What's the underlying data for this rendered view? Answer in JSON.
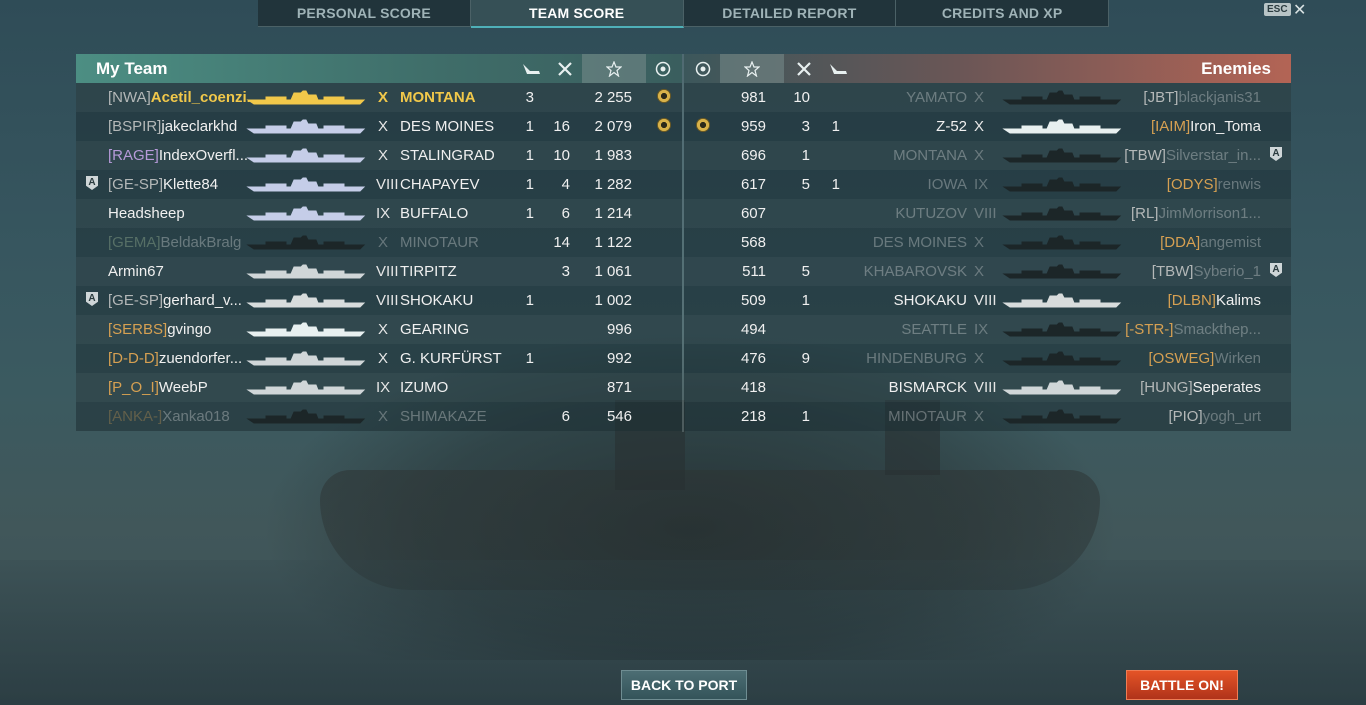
{
  "tabs": [
    "PERSONAL SCORE",
    "TEAM SCORE",
    "DETAILED REPORT",
    "CREDITS AND XP"
  ],
  "esc_label": "ESC",
  "close_glyph": "✕",
  "left_panel": {
    "title": "My Team",
    "rows": [
      {
        "tag": "[NWA]",
        "name": "Acetil_coenzi...",
        "tier": "X",
        "ship": "MONTANA",
        "c1": "3",
        "c2": "",
        "score": "2 255",
        "medal": true,
        "highlight": true,
        "dead": false,
        "tag_color": "grey",
        "sil_color": "#f1c84a"
      },
      {
        "tag": "[BSPIR]",
        "name": "jakeclarkhd",
        "tier": "X",
        "ship": "DES MOINES",
        "c1": "1",
        "c2": "16",
        "score": "2 079",
        "medal": true,
        "dead": false,
        "tag_color": "grey",
        "sil_color": "#c5cde8"
      },
      {
        "tag": "[RAGE]",
        "name": "IndexOverfl...",
        "tier": "X",
        "ship": "STALINGRAD",
        "c1": "1",
        "c2": "10",
        "score": "1 983",
        "dead": false,
        "tag_color": "purple",
        "sil_color": "#c5cde8"
      },
      {
        "tag": "[GE-SP]",
        "name": "Klette84",
        "tier": "VIII",
        "ship": "CHAPAYEV",
        "c1": "1",
        "c2": "4",
        "score": "1 282",
        "dead": false,
        "tag_color": "grey",
        "sil_color": "#c5cde8",
        "division": true
      },
      {
        "tag": "",
        "name": "Headsheep",
        "tier": "IX",
        "ship": "BUFFALO",
        "c1": "1",
        "c2": "6",
        "score": "1 214",
        "dead": false,
        "tag_color": "grey",
        "sil_color": "#c5cde8"
      },
      {
        "tag": "[GEMA]",
        "name": "BeldakBralg",
        "tier": "X",
        "ship": "MINOTAUR",
        "c1": "",
        "c2": "14",
        "score": "1 122",
        "dead": true,
        "tag_color": "green",
        "sil_color": "#1c2628"
      },
      {
        "tag": "",
        "name": "Armin67",
        "tier": "VIII",
        "ship": "TIRPITZ",
        "c1": "",
        "c2": "3",
        "score": "1 061",
        "dead": false,
        "tag_color": "grey",
        "sil_color": "#d0d6d8"
      },
      {
        "tag": "[GE-SP]",
        "name": "gerhard_v...",
        "tier": "VIII",
        "ship": "SHOKAKU",
        "c1": "1",
        "c2": "",
        "score": "1 002",
        "dead": false,
        "tag_color": "grey",
        "sil_color": "#d8dcdc",
        "division": true
      },
      {
        "tag": "[SERBS]",
        "name": "gvingo",
        "tier": "X",
        "ship": "GEARING",
        "c1": "",
        "c2": "",
        "score": "996",
        "dead": false,
        "tag_color": "orange",
        "sil_color": "#e8f0f0"
      },
      {
        "tag": "[D-D-D]",
        "name": "zuendorfer...",
        "tier": "X",
        "ship": "G. KURFÜRST",
        "c1": "1",
        "c2": "",
        "score": "992",
        "dead": false,
        "tag_color": "orange",
        "sil_color": "#d0d6d8"
      },
      {
        "tag": "[P_O_I]",
        "name": "WeebP",
        "tier": "IX",
        "ship": "IZUMO",
        "c1": "",
        "c2": "",
        "score": "871",
        "dead": false,
        "tag_color": "orange",
        "sil_color": "#d0d6d8"
      },
      {
        "tag": "[ANKA-]",
        "name": "Xanka018",
        "tier": "X",
        "ship": "SHIMAKAZE",
        "c1": "",
        "c2": "6",
        "score": "546",
        "dead": true,
        "tag_color": "orange",
        "sil_color": "#1c2628"
      }
    ]
  },
  "right_panel": {
    "title": "Enemies",
    "rows": [
      {
        "medal": false,
        "score": "981",
        "c1": "10",
        "c2": "",
        "ship": "YAMATO",
        "tier": "X",
        "tag": "[JBT]",
        "name": "blackjanis31",
        "dead": true,
        "tag_color": "grey",
        "sil_color": "#1c2628"
      },
      {
        "medal": true,
        "score": "959",
        "c1": "3",
        "c2": "1",
        "ship": "Z-52",
        "tier": "X",
        "tag": "[IAIM]",
        "name": "Iron_Toma",
        "dead": false,
        "tag_color": "orange",
        "sil_color": "#e8f0f0"
      },
      {
        "medal": false,
        "score": "696",
        "c1": "1",
        "c2": "",
        "ship": "MONTANA",
        "tier": "X",
        "tag": "[TBW]",
        "name": "Silverstar_in...",
        "dead": true,
        "tag_color": "grey",
        "sil_color": "#1c2628",
        "division": true
      },
      {
        "medal": false,
        "score": "617",
        "c1": "5",
        "c2": "1",
        "ship": "IOWA",
        "tier": "IX",
        "tag": "[ODYS]",
        "name": "renwis",
        "dead": true,
        "tag_color": "orange",
        "sil_color": "#1c2628"
      },
      {
        "medal": false,
        "score": "607",
        "c1": "",
        "c2": "",
        "ship": "KUTUZOV",
        "tier": "VIII",
        "tag": "[RL]",
        "name": "JimMorrison1...",
        "dead": true,
        "tag_color": "grey",
        "sil_color": "#1c2628"
      },
      {
        "medal": false,
        "score": "568",
        "c1": "",
        "c2": "",
        "ship": "DES MOINES",
        "tier": "X",
        "tag": "[DDA]",
        "name": "angemist",
        "dead": true,
        "tag_color": "orange",
        "sil_color": "#1c2628"
      },
      {
        "medal": false,
        "score": "511",
        "c1": "5",
        "c2": "",
        "ship": "KHABAROVSK",
        "tier": "X",
        "tag": "[TBW]",
        "name": "Syberio_1",
        "dead": true,
        "tag_color": "grey",
        "sil_color": "#1c2628",
        "division": true
      },
      {
        "medal": false,
        "score": "509",
        "c1": "1",
        "c2": "",
        "ship": "SHOKAKU",
        "tier": "VIII",
        "tag": "[DLBN]",
        "name": "Kalims",
        "dead": false,
        "tag_color": "orange",
        "sil_color": "#d8dcdc"
      },
      {
        "medal": false,
        "score": "494",
        "c1": "",
        "c2": "",
        "ship": "SEATTLE",
        "tier": "IX",
        "tag": "[-STR-]",
        "name": "Smackthep...",
        "dead": true,
        "tag_color": "orange",
        "sil_color": "#1c2628"
      },
      {
        "medal": false,
        "score": "476",
        "c1": "9",
        "c2": "",
        "ship": "HINDENBURG",
        "tier": "X",
        "tag": "[OSWEG]",
        "name": "Wirken",
        "dead": true,
        "tag_color": "orange",
        "sil_color": "#1c2628"
      },
      {
        "medal": false,
        "score": "418",
        "c1": "",
        "c2": "",
        "ship": "BISMARCK",
        "tier": "VIII",
        "tag": "[HUNG]",
        "name": "Seperates",
        "dead": false,
        "tag_color": "grey",
        "sil_color": "#d0d6d8"
      },
      {
        "medal": false,
        "score": "218",
        "c1": "1",
        "c2": "",
        "ship": "MINOTAUR",
        "tier": "X",
        "tag": "[PIO]",
        "name": "yogh_urt",
        "dead": true,
        "tag_color": "grey",
        "sil_color": "#1c2628"
      }
    ]
  },
  "buttons": {
    "back": "BACK TO PORT",
    "battle": "BATTLE ON!"
  },
  "icons": {
    "aircraft": "aircraft-shot-down-icon",
    "frags": "ships-destroyed-icon",
    "star": "base-xp-star-icon",
    "medal": "achievement-medal-icon",
    "division": "division-icon"
  },
  "colors": {
    "my_team_header": "#4c8e83",
    "enemy_header": "#b36455",
    "highlight": "#f1c84a",
    "battle_button": "#e45427"
  }
}
